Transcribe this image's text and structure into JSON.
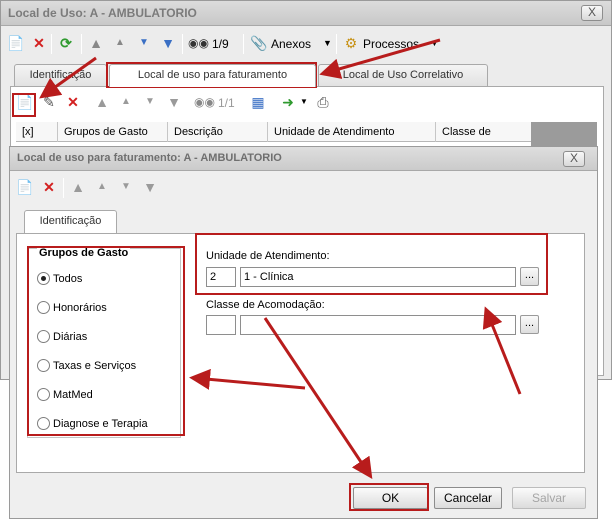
{
  "outer_window": {
    "title": "Local de Uso: A - AMBULATORIO",
    "close_label": "X",
    "toolbar": {
      "record_counter": "1/9",
      "anexos_label": "Anexos",
      "processos_label": "Processos"
    },
    "tabs": [
      {
        "label": "Identificação"
      },
      {
        "label": "Local de uso para faturamento"
      },
      {
        "label": "Local de Uso Correlativo"
      }
    ],
    "sub_toolbar": {
      "record_counter": "1/1"
    },
    "grid": {
      "columns": [
        "[x]",
        "Grupos de Gasto",
        "Descrição",
        "Unidade de Atendimento",
        "Classe de"
      ]
    }
  },
  "dialog": {
    "title": "Local de uso para faturamento: A - AMBULATORIO",
    "close_label": "X",
    "tab_label": "Identificação",
    "grupos": {
      "legend": "Grupos de Gasto",
      "options": [
        "Todos",
        "Honorários",
        "Diárias",
        "Taxas e Serviços",
        "MatMed",
        "Diagnose e Terapia"
      ],
      "selected": "Todos"
    },
    "unidade": {
      "label": "Unidade de Atendimento:",
      "code": "2",
      "name": "1 - Clínica",
      "lookup_label": "..."
    },
    "classe": {
      "label": "Classe de Acomodação:",
      "code": "",
      "name": "",
      "lookup_label": "..."
    },
    "buttons": {
      "ok": "OK",
      "cancel": "Cancelar",
      "save": "Salvar"
    }
  },
  "icons": {
    "new": "new-document-icon",
    "delete": "delete-x-icon",
    "refresh": "refresh-icon",
    "first": "first-record-icon",
    "prev": "previous-record-icon",
    "next": "next-record-icon",
    "last": "last-record-icon",
    "find": "binoculars-icon",
    "attach": "paperclip-icon",
    "process": "gears-icon",
    "edit": "edit-document-icon",
    "grid": "grid-view-icon",
    "export": "export-icon",
    "print": "printer-icon"
  },
  "colors": {
    "highlight_red": "#b81c1c",
    "delete_red": "#d32020",
    "nav_blue": "#3a6fc4",
    "refresh_green": "#2f9a2f"
  }
}
